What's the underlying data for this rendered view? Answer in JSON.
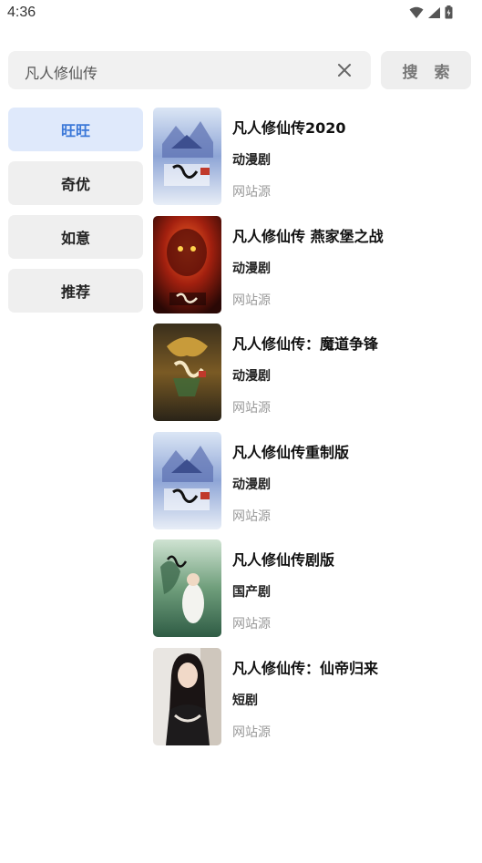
{
  "status": {
    "time": "4:36"
  },
  "search": {
    "query": "凡人修仙传",
    "button_label": "搜 索"
  },
  "sources": [
    {
      "label": "旺旺",
      "active": true
    },
    {
      "label": "奇优",
      "active": false
    },
    {
      "label": "如意",
      "active": false
    },
    {
      "label": "推荐",
      "active": false
    }
  ],
  "results": [
    {
      "title": "凡人修仙传2020",
      "type": "动漫剧",
      "source": "网站源",
      "poster": "poster-blue-palace"
    },
    {
      "title": "凡人修仙传 燕家堡之战",
      "type": "动漫剧",
      "source": "网站源",
      "poster": "poster-red-demon"
    },
    {
      "title": "凡人修仙传：魔道争锋",
      "type": "动漫剧",
      "source": "网站源",
      "poster": "poster-gold-dragon"
    },
    {
      "title": "凡人修仙传重制版",
      "type": "动漫剧",
      "source": "网站源",
      "poster": "poster-blue-palace"
    },
    {
      "title": "凡人修仙传剧版",
      "type": "国产剧",
      "source": "网站源",
      "poster": "poster-green-drama"
    },
    {
      "title": "凡人修仙传：仙帝归来",
      "type": "短剧",
      "source": "网站源",
      "poster": "poster-portrait"
    }
  ],
  "colors": {
    "accent": "#3b78d8",
    "active_bg": "#dfe9fb",
    "item_bg": "#efefef"
  }
}
